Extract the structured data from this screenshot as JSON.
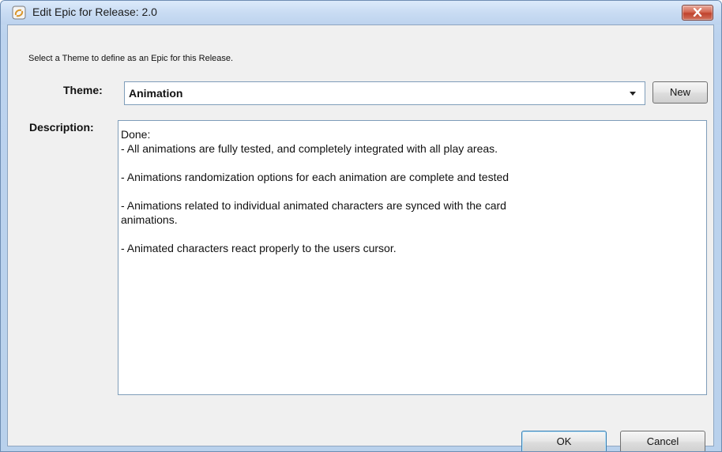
{
  "window": {
    "title": "Edit Epic for Release: 2.0"
  },
  "dialog": {
    "instruction": "Select a Theme to define as an Epic for this Release.",
    "theme": {
      "label": "Theme:",
      "value": "Animation",
      "new_button_label": "New"
    },
    "description": {
      "label": "Description:",
      "lines": [
        "Done:",
        "- All animations are fully tested, and completely integrated with all play areas.",
        "",
        "- Animations randomization options for each animation are complete and tested",
        "",
        "- Animations related to individual animated characters are synced with the card",
        "animations.",
        "",
        "- Animated characters react properly to the users cursor."
      ]
    },
    "buttons": {
      "ok_label": "OK",
      "cancel_label": "Cancel"
    }
  },
  "icons": {
    "app": "app-logo-icon",
    "close": "close-icon",
    "dropdown": "chevron-down-icon"
  },
  "colors": {
    "close_button": "#c0432c",
    "window_frame": "#bcd3ee",
    "client_background": "#f0f0f0"
  }
}
